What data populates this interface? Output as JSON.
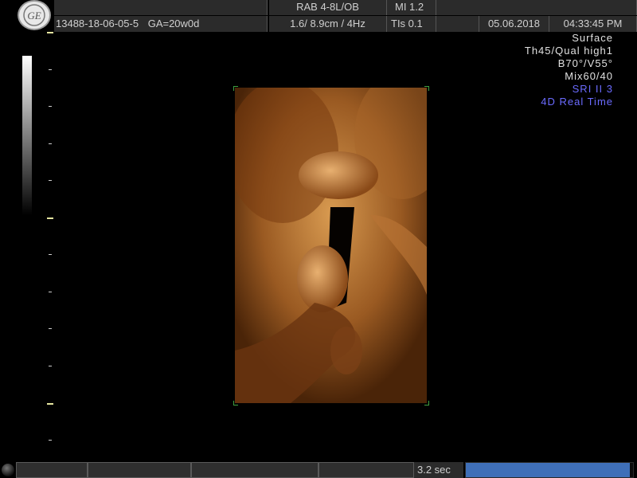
{
  "header": {
    "logo_text": "GE",
    "probe": "RAB 4-8L/OB",
    "mi": "MI  1.2",
    "patient_id": "13488-18-06-05-5",
    "ga": "GA=20w0d",
    "depth_freq": "1.6/ 8.9cm /  4Hz",
    "tis": "TIs  0.1",
    "date": "05.06.2018",
    "time": "04:33:45 PM"
  },
  "info": {
    "lines": [
      "Surface",
      "Th45/Qual high1",
      "B70°/V55°",
      "Mix60/40"
    ],
    "blue_lines": [
      "SRI II 3",
      "4D Real Time"
    ]
  },
  "footer": {
    "sec": "3.2 sec",
    "progress": 0.98
  },
  "colors": {
    "accent_blue": "#6b6bff",
    "progress_blue": "#3f6fb8",
    "render_orange": "#c07a36"
  },
  "icons": [
    "ge-logo-icon",
    "trackball-icon"
  ]
}
